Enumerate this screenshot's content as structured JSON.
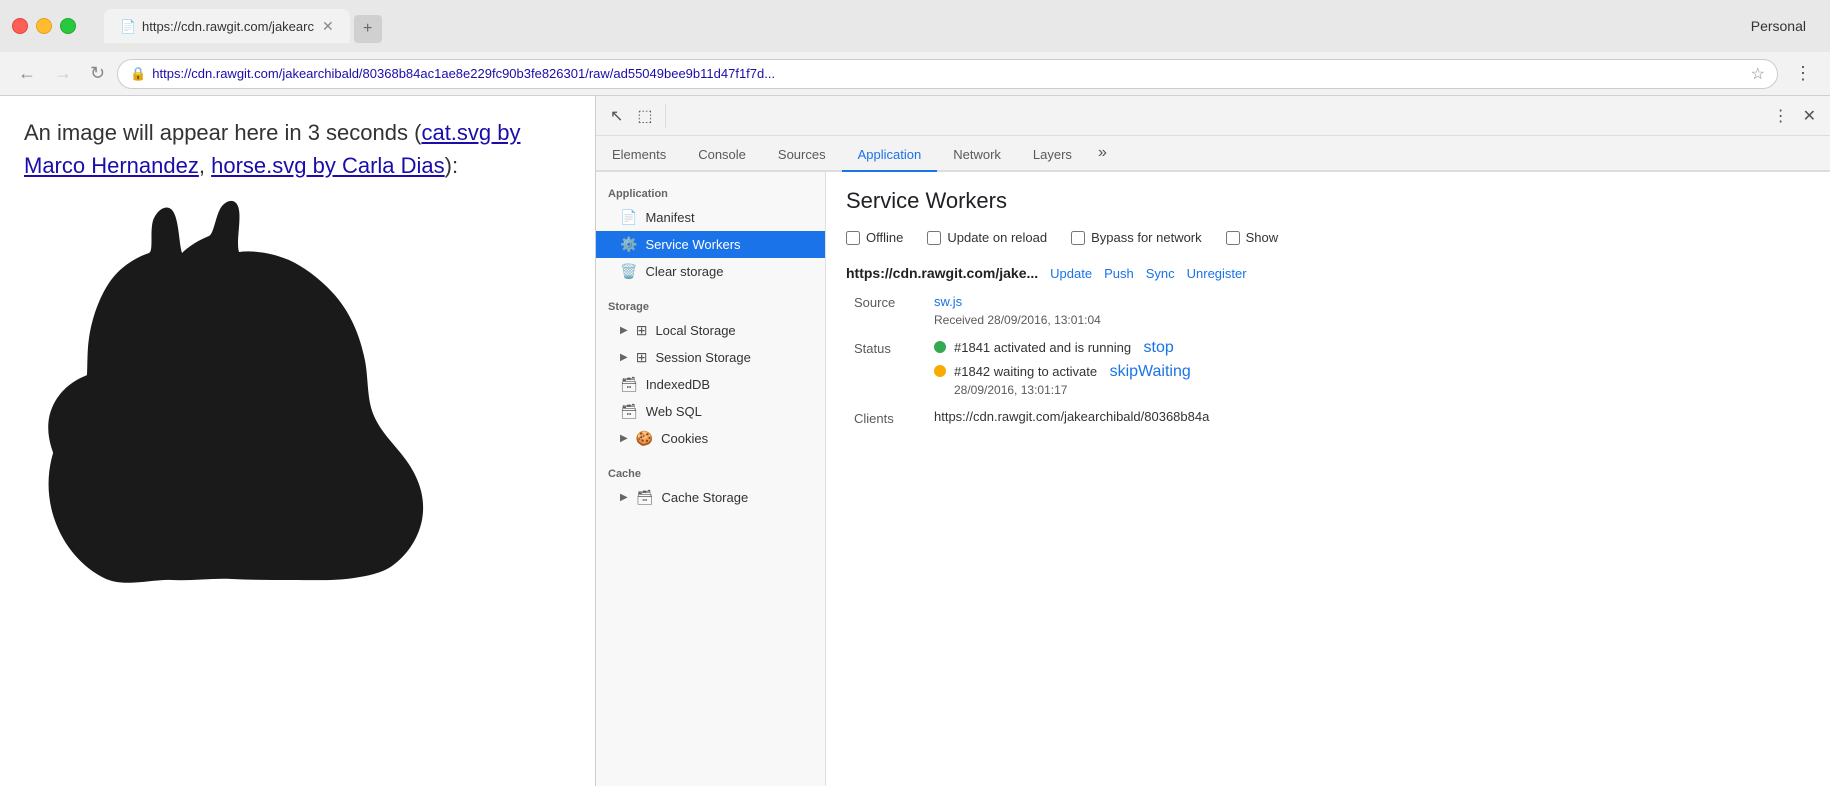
{
  "browser": {
    "tab_title": "https://cdn.rawgit.com/jakearc",
    "url": "https://cdn.rawgit.com/jakearchibald/80368b84ac1ae8e229fc90b3fe826301/raw/ad55049bee9b11d47f1f7d...",
    "url_display": "https://cdn.rawgit.com/jakearchibald/80368b84ac1ae8e229fc90b3fe826301/raw/ad55049bee9b11d47f1f7d...",
    "profile": "Personal"
  },
  "page": {
    "intro_text": "An image will appear here in 3 seconds (",
    "link1_text": "cat.svg by Marco Hernandez",
    "link2_text": "horse.svg by Carla Dias",
    "end_text": "):"
  },
  "devtools": {
    "tabs": [
      {
        "id": "elements",
        "label": "Elements"
      },
      {
        "id": "console",
        "label": "Console"
      },
      {
        "id": "sources",
        "label": "Sources"
      },
      {
        "id": "application",
        "label": "Application"
      },
      {
        "id": "network",
        "label": "Network"
      },
      {
        "id": "layers",
        "label": "Layers"
      }
    ],
    "active_tab": "application",
    "sidebar": {
      "section_application": "Application",
      "items_application": [
        {
          "id": "manifest",
          "label": "Manifest",
          "icon": "📄"
        },
        {
          "id": "service-workers",
          "label": "Service Workers",
          "icon": "⚙️",
          "active": true
        },
        {
          "id": "clear-storage",
          "label": "Clear storage",
          "icon": "🗑️"
        }
      ],
      "section_storage": "Storage",
      "items_storage": [
        {
          "id": "local-storage",
          "label": "Local Storage",
          "has_arrow": true
        },
        {
          "id": "session-storage",
          "label": "Session Storage",
          "has_arrow": true
        },
        {
          "id": "indexeddb",
          "label": "IndexedDB",
          "has_arrow": false
        },
        {
          "id": "web-sql",
          "label": "Web SQL",
          "has_arrow": false
        },
        {
          "id": "cookies",
          "label": "Cookies",
          "has_arrow": true
        }
      ],
      "section_cache": "Cache",
      "items_cache": [
        {
          "id": "cache-storage",
          "label": "Cache Storage",
          "has_arrow": true
        }
      ]
    },
    "panel": {
      "title": "Service Workers",
      "checkboxes": [
        {
          "id": "offline",
          "label": "Offline",
          "checked": false
        },
        {
          "id": "update-on-reload",
          "label": "Update on reload",
          "checked": false
        },
        {
          "id": "bypass-for-network",
          "label": "Bypass for network",
          "checked": false
        },
        {
          "id": "show",
          "label": "Show",
          "checked": false
        }
      ],
      "sw_url": "https://cdn.rawgit.com/jake...",
      "sw_actions": [
        "Update",
        "Push",
        "Sync",
        "Unregister"
      ],
      "source_label": "Source",
      "source_link": "sw.js",
      "received_text": "Received 28/09/2016, 13:01:04",
      "status_label": "Status",
      "status_items": [
        {
          "dot": "green",
          "text": "#1841 activated and is running",
          "link": "stop",
          "timestamp": null
        },
        {
          "dot": "orange",
          "text": "#1842 waiting to activate",
          "link": "skipWaiting",
          "timestamp": "28/09/2016, 13:01:17"
        }
      ],
      "clients_label": "Clients",
      "clients_value": "https://cdn.rawgit.com/jakearchibald/80368b84a"
    }
  }
}
